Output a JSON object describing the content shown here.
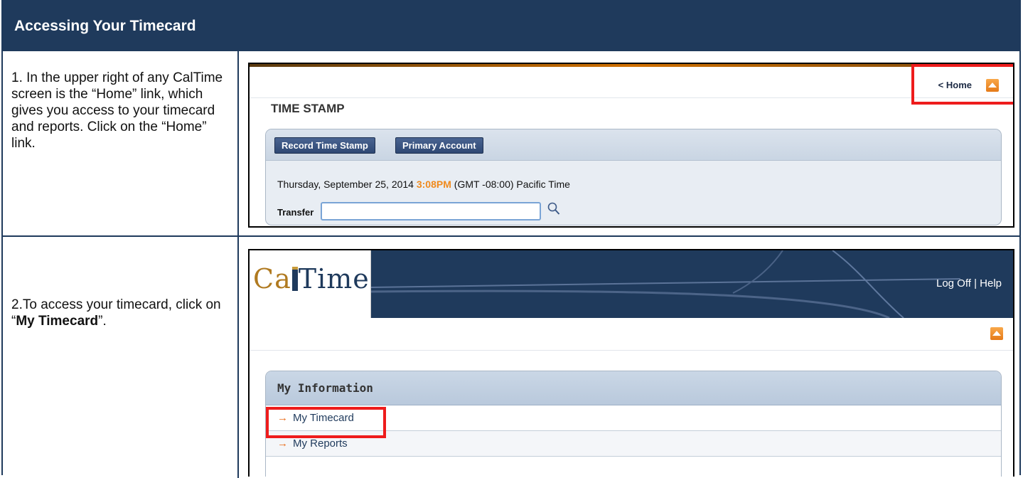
{
  "header": {
    "title": "Accessing Your Timecard"
  },
  "steps": [
    {
      "text": "1. In the upper right of any CalTime screen is the “Home” link, which gives you access to your timecard and reports. Click on the “Home” link."
    },
    {
      "text_prefix": "2.To access your timecard, click on “",
      "text_bold": "My Timecard",
      "text_suffix": "”."
    }
  ],
  "screenshot1": {
    "home_link": "< Home",
    "section_title": "TIME STAMP",
    "buttons": [
      "Record Time Stamp",
      "Primary Account"
    ],
    "datetime_date": "Thursday, September 25, 2014",
    "datetime_time": "3:08PM",
    "datetime_zone": "(GMT -08:00) Pacific Time",
    "transfer_label": "Transfer",
    "transfer_value": ""
  },
  "screenshot2": {
    "logo_text_ca": "Ca",
    "logo_text_time": "Time",
    "header_links": "Log Off | Help",
    "panel_title": "My Information",
    "menu_items": [
      "My Timecard",
      "My Reports"
    ]
  },
  "colors": {
    "navy": "#1f3a5c",
    "highlight_red": "#ee1c1c",
    "accent_orange": "#f08a1c"
  }
}
